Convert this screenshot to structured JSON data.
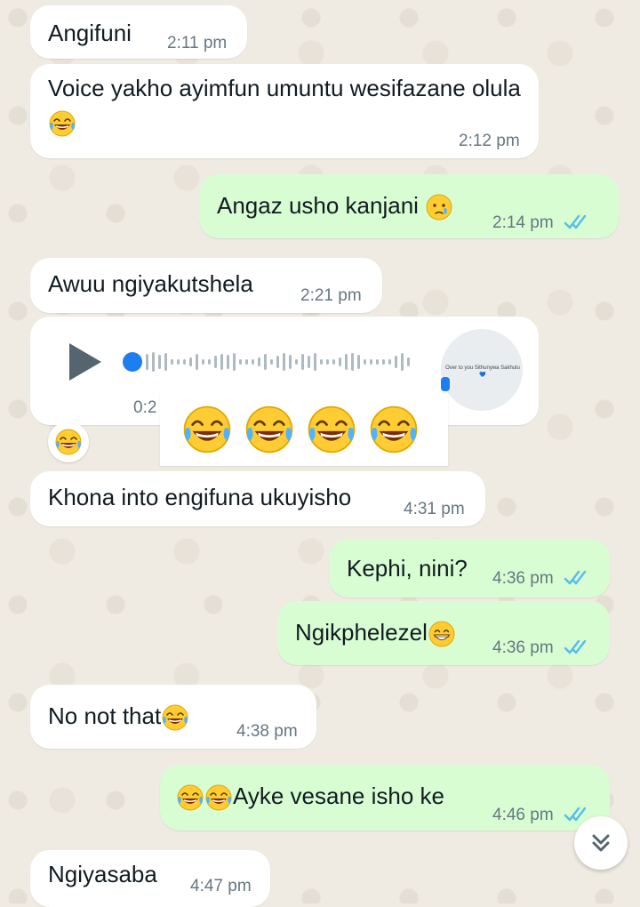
{
  "messages": [
    {
      "text": "Angifuni",
      "time": "2:11 pm"
    },
    {
      "text": "Voice yakho ayimfun umuntu wesifazane olula",
      "time": "2:12 pm"
    },
    {
      "text": "Angaz usho kanjani",
      "time": "2:14 pm"
    },
    {
      "text": "Awuu ngiyakutshela",
      "time": "2:21 pm"
    },
    {
      "text": "Khona into engifuna ukuyisho",
      "time": "4:31 pm"
    },
    {
      "text": "Kephi, nini?",
      "time": "4:36 pm"
    },
    {
      "text": "Ngikphelezel",
      "time": "4:36 pm"
    },
    {
      "text": "No not that",
      "time": "4:38 pm"
    },
    {
      "text": "Ayke vesane isho ke",
      "time": "4:46 pm"
    },
    {
      "text": "Ngiyasaba",
      "time": "4:47 pm"
    }
  ],
  "voice_note": {
    "duration": "0:2",
    "avatar_caption": "Over to you Sithunywa Sakhulu 💙",
    "reaction_icon": "face-with-tears-of-joy",
    "reaction_bar_icons": [
      "face-with-tears-of-joy",
      "face-with-tears-of-joy",
      "face-with-tears-of-joy",
      "face-with-tears-of-joy"
    ]
  },
  "colors": {
    "background": "#efeae2",
    "incoming_bubble": "#ffffff",
    "outgoing_bubble": "#d9fdd3",
    "read_ticks": "#53bdeb",
    "play_button": "#54656f",
    "voice_progress_dot": "#1d7ef0"
  },
  "icons": {
    "read_receipt": "double-check-icon",
    "scroll_down": "double-chevron-down-icon",
    "play": "play-icon"
  }
}
